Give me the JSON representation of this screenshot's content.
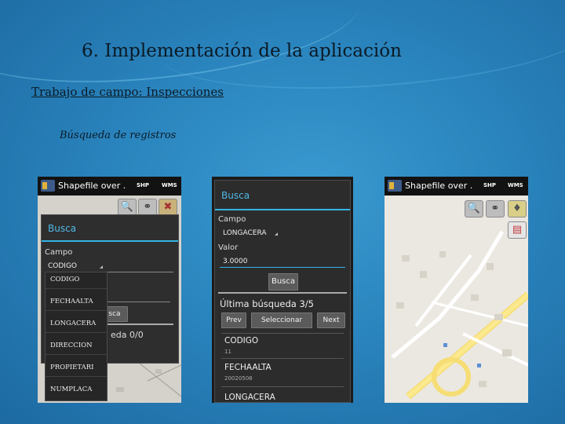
{
  "slide": {
    "title": "6. Implementación de la aplicación",
    "subtitle": "Trabajo de campo: Inspecciones",
    "subsubtitle": "Búsqueda de registros"
  },
  "app": {
    "title": "Shapefile over .",
    "shp_label": "SHP",
    "wms_label": "WMS"
  },
  "screen1": {
    "dialog_title": "Busca",
    "campo_label": "Campo",
    "campo_value": "CODIGO",
    "button_partial": "sca",
    "result_partial": "eda 0/0",
    "dropdown_options": [
      "CODIGO",
      "FECHAALTA",
      "LONGACERA",
      "DIRECCION",
      "PROPIETARI",
      "NUMPLACA"
    ]
  },
  "screen2": {
    "dialog_title": "Busca",
    "campo_label": "Campo",
    "campo_value": "LONGACERA",
    "valor_label": "Valor",
    "valor_value": "3.0000",
    "search_button": "Busca",
    "last_search": "Última búsqueda 3/5",
    "prev_button": "Prev",
    "select_button": "Seleccionar",
    "next_button": "Next",
    "results": [
      {
        "field": "CODIGO",
        "value": "11"
      },
      {
        "field": "FECHAALTA",
        "value": "20020508"
      },
      {
        "field": "LONGACERA",
        "value": ""
      }
    ]
  },
  "colors": {
    "accent": "#33b5e5",
    "dialog_bg": "#2e2e2e",
    "slide_bg": "#2a84bd"
  },
  "icons": [
    "zoom-icon",
    "binoculars-icon",
    "info-marker-icon",
    "pdf-document-icon",
    "logo-icon"
  ]
}
